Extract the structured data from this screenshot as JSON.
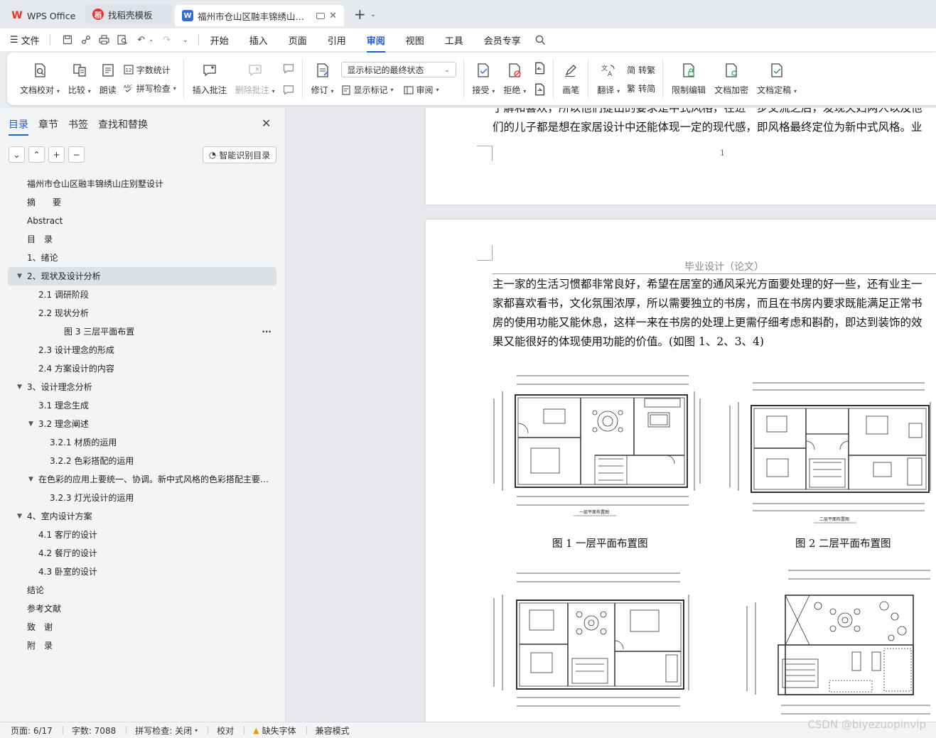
{
  "tabs": [
    {
      "label": "WPS Office"
    },
    {
      "label": "找稻壳模板"
    },
    {
      "label": "福州市仓山区融丰锦绣山庄别墅"
    }
  ],
  "menubar": {
    "file": "文件",
    "tabs": [
      "开始",
      "插入",
      "页面",
      "引用",
      "审阅",
      "视图",
      "工具",
      "会员专享"
    ],
    "active": "审阅"
  },
  "ribbon": {
    "doc_check": "文档校对",
    "compare": "比较",
    "read_aloud": "朗读",
    "word_count": "字数统计",
    "spell_check": "拼写检查",
    "insert_comment": "插入批注",
    "delete_comment": "删除批注",
    "revise": "修订",
    "markup_state": "显示标记的最终状态",
    "show_markup": "显示标记",
    "review": "审阅",
    "accept": "接受",
    "reject": "拒绝",
    "pen": "画笔",
    "translate": "翻译",
    "to_traditional": "转繁",
    "to_simplified": "转简",
    "restrict_edit": "限制编辑",
    "encrypt": "文档加密",
    "finalize": "文档定稿"
  },
  "navpane": {
    "tabs": [
      "目录",
      "章节",
      "书签",
      "查找和替换"
    ],
    "smart_toc": "智能识别目录",
    "toc": [
      {
        "text": "福州市仓山区融丰锦绣山庄别墅设计",
        "level": 0
      },
      {
        "text": "摘　　要",
        "level": 0
      },
      {
        "text": "Abstract",
        "level": 0
      },
      {
        "text": "目　录",
        "level": 0
      },
      {
        "text": "1、绪论",
        "level": 0
      },
      {
        "text": "2、现状及设计分析",
        "level": 0
      },
      {
        "text": "2.1 调研阶段",
        "level": 1
      },
      {
        "text": "2.2 现状分析",
        "level": 1
      },
      {
        "text": "图 3 三层平面布置",
        "level": 3
      },
      {
        "text": "2.3 设计理念的形成",
        "level": 1
      },
      {
        "text": "2.4 方案设计的内容",
        "level": 1
      },
      {
        "text": "3、设计理念分析",
        "level": 0
      },
      {
        "text": "3.1 理念生成",
        "level": 1
      },
      {
        "text": "3.2 理念阐述",
        "level": 1
      },
      {
        "text": "3.2.1 材质的运用",
        "level": 2
      },
      {
        "text": "3.2.2 色彩搭配的运用",
        "level": 2
      },
      {
        "text": "在色彩的应用上要统一、协调。新中式风格的色彩搭配主要…",
        "level": 1
      },
      {
        "text": "3.2.3 灯光设计的运用",
        "level": 2
      },
      {
        "text": "4、室内设计方案",
        "level": 0
      },
      {
        "text": "4.1 客厅的设计",
        "level": 1
      },
      {
        "text": "4.2 餐厅的设计",
        "level": 1
      },
      {
        "text": "4.3 卧室的设计",
        "level": 1
      },
      {
        "text": "结论",
        "level": 0
      },
      {
        "text": "参考文献",
        "level": 0
      },
      {
        "text": "致　谢",
        "level": 0
      },
      {
        "text": "附　录",
        "level": 0
      }
    ]
  },
  "document": {
    "page1_lines": [
      "了解和喜欢，所以他们提出的要求是中式风格，在进一步交流之后，发现夫妇两人以及他",
      "们的儿子都是想在家居设计中还能体现一定的现代感，即风格最终定位为新中式风格。业"
    ],
    "page1_number": "1",
    "page2_header": "毕业设计（论文）",
    "page2_lines": [
      "主一家的生活习惯都非常良好，希望在居室的通风采光方面要处理的好一些，还有业主一",
      "家都喜欢看书，文化氛围浓厚，所以需要独立的书房，而且在书房内要求既能满足正常书",
      "房的使用功能又能休息，这样一来在书房的处理上更需仔细考虑和斟酌，即达到装饰的效",
      "果又能很好的体现使用功能的价值。(如图 1、2、3、4)"
    ],
    "figure1_title": "一层平面布置图",
    "figure2_title": "二层平面布置图",
    "caption1": "图 1 一层平面布置图",
    "caption2": "图 2 二层平面布置图"
  },
  "statusbar": {
    "page": "页面: 6/17",
    "words": "字数: 7088",
    "spell": "拼写检查: 关闭",
    "proof": "校对",
    "missing_font": "缺失字体",
    "compat": "兼容模式"
  },
  "watermark": "CSDN @biyezuopinvip"
}
